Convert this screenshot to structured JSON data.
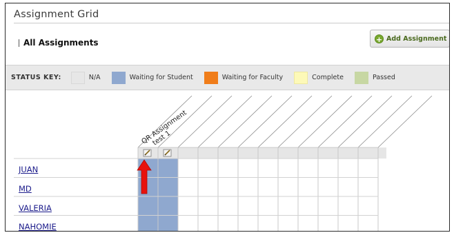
{
  "page": {
    "title": "Assignment Grid",
    "breadcrumb": "All Assignments",
    "add_button_label": "Add Assignment"
  },
  "status_key": {
    "label": "STATUS KEY:",
    "items": [
      {
        "label": "N/A",
        "color": "#e7e7e7"
      },
      {
        "label": "Waiting for Student",
        "color": "#8fa8cf"
      },
      {
        "label": "Waiting for Faculty",
        "color": "#f07d1a"
      },
      {
        "label": "Complete",
        "color": "#fdf9b8"
      },
      {
        "label": "Passed",
        "color": "#c7d7a3"
      }
    ]
  },
  "assignments": [
    {
      "name": "QR Assignment",
      "status_color": "#8fa8cf"
    },
    {
      "name": "test 1",
      "status_color": "#8fa8cf"
    }
  ],
  "students": [
    "JUAN",
    "MD",
    "VALERIA",
    "NAHOMIE"
  ],
  "icons": {
    "edit": "edit-icon",
    "add": "plus-circle-icon",
    "pointer": "red-arrow-up-icon"
  },
  "colors": {
    "waiting_student": "#8fa8cf",
    "arrow": "#e8120c"
  }
}
